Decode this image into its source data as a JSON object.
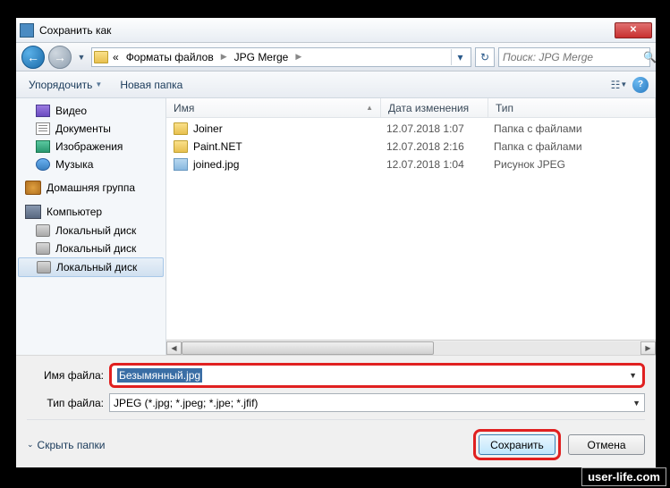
{
  "window": {
    "title": "Сохранить как"
  },
  "nav": {
    "path_prefix": "«",
    "segments": [
      "Форматы файлов",
      "JPG Merge"
    ],
    "search_placeholder": "Поиск: JPG Merge"
  },
  "toolbar": {
    "organize": "Упорядочить",
    "new_folder": "Новая папка"
  },
  "sidebar": {
    "items": [
      {
        "label": "Видео"
      },
      {
        "label": "Документы"
      },
      {
        "label": "Изображения"
      },
      {
        "label": "Музыка"
      }
    ],
    "homegroup": "Домашняя группа",
    "computer": "Компьютер",
    "disks": [
      {
        "label": "Локальный диск"
      },
      {
        "label": "Локальный диск"
      },
      {
        "label": "Локальный диск"
      }
    ]
  },
  "columns": {
    "name": "Имя",
    "date": "Дата изменения",
    "type": "Тип"
  },
  "files": [
    {
      "name": "Joiner",
      "date": "12.07.2018 1:07",
      "type": "Папка с файлами",
      "kind": "folder"
    },
    {
      "name": "Paint.NET",
      "date": "12.07.2018 2:16",
      "type": "Папка с файлами",
      "kind": "folder"
    },
    {
      "name": "joined.jpg",
      "date": "12.07.2018 1:04",
      "type": "Рисунок JPEG",
      "kind": "image"
    }
  ],
  "bottom": {
    "filename_label": "Имя файла:",
    "filename_value": "Безымянный.jpg",
    "filetype_label": "Тип файла:",
    "filetype_value": "JPEG (*.jpg; *.jpeg; *.jpe; *.jfif)",
    "hide_folders": "Скрыть папки",
    "save": "Сохранить",
    "cancel": "Отмена"
  },
  "watermark": "user-life.com"
}
